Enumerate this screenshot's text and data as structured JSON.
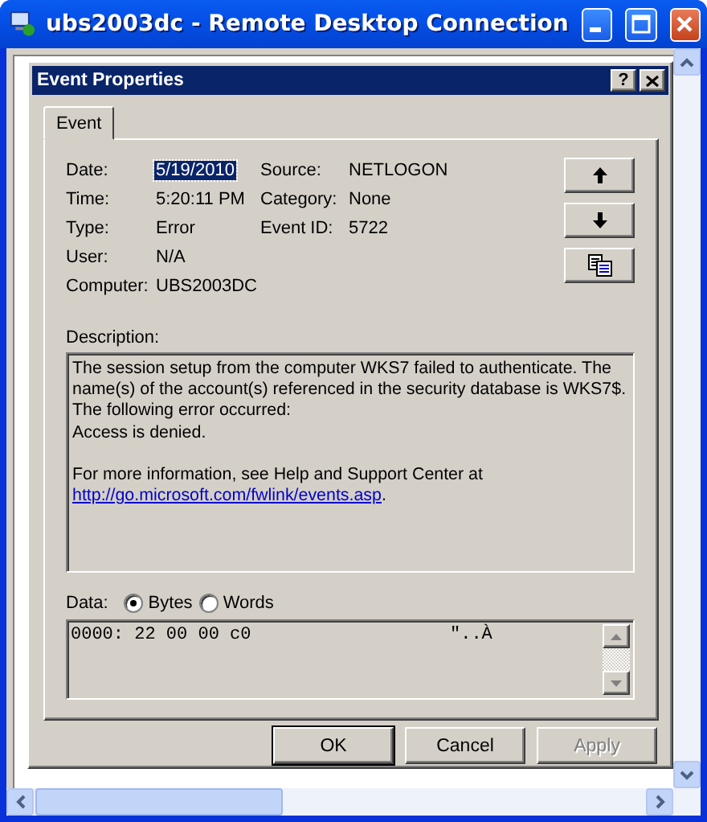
{
  "window": {
    "title": "ubs2003dc - Remote Desktop Connection"
  },
  "dialog": {
    "title": "Event Properties",
    "help": "?"
  },
  "tabs": [
    {
      "label": "Event",
      "selected": true
    }
  ],
  "details_left": [
    {
      "label": "Date:",
      "value": "5/19/2010",
      "selected": true
    },
    {
      "label": "Time:",
      "value": "5:20:11 PM",
      "selected": false
    },
    {
      "label": "Type:",
      "value": "Error",
      "selected": false
    },
    {
      "label": "User:",
      "value": "N/A",
      "selected": false
    },
    {
      "label": "Computer:",
      "value": "UBS2003DC",
      "selected": false
    }
  ],
  "details_right": [
    {
      "label": "Source:",
      "value": "NETLOGON"
    },
    {
      "label": "Category:",
      "value": "None"
    },
    {
      "label": "Event ID:",
      "value": "5722"
    }
  ],
  "description": {
    "label": "Description:",
    "paragraphs": [
      {
        "lines": [
          "The session setup from the computer WKS7 failed to authenticate. The",
          "name(s) of the account(s) referenced in the security database is WKS7$.",
          "The following error occurred:",
          "Access is denied."
        ]
      },
      {
        "lines": [
          "For more information, see Help and Support Center at"
        ],
        "link": "http://go.microsoft.com/fwlink/events.asp",
        "after_link": "."
      }
    ]
  },
  "data": {
    "label": "Data:",
    "formats": [
      {
        "label": "Bytes",
        "selected": true
      },
      {
        "label": "Words",
        "selected": false
      }
    ],
    "rows": [
      {
        "bytes": "0000: 22 00 00 c0",
        "chars": "\"..À"
      }
    ]
  },
  "buttons": [
    {
      "label": "OK",
      "default": true,
      "disabled": false
    },
    {
      "label": "Cancel",
      "default": false,
      "disabled": false
    },
    {
      "label": "Apply",
      "default": false,
      "disabled": true
    }
  ]
}
